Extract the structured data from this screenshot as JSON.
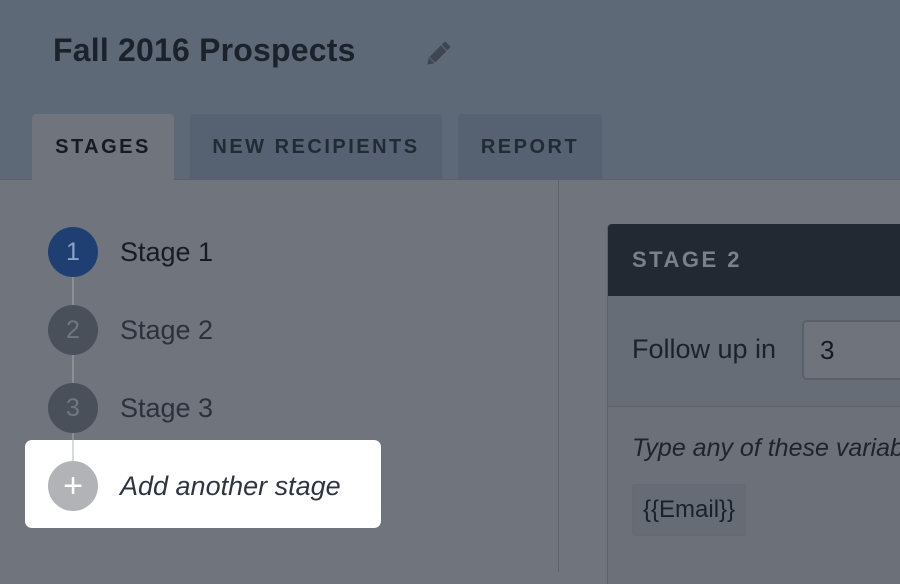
{
  "header": {
    "title": "Fall 2016 Prospects",
    "edit_icon": "pencil-icon"
  },
  "tabs": [
    {
      "label": "STAGES",
      "active": true
    },
    {
      "label": "NEW RECIPIENTS",
      "active": false
    },
    {
      "label": "REPORT",
      "active": false
    }
  ],
  "stages": [
    {
      "number": "1",
      "label": "Stage 1",
      "active": true
    },
    {
      "number": "2",
      "label": "Stage 2",
      "active": false
    },
    {
      "number": "3",
      "label": "Stage 3",
      "active": false
    }
  ],
  "add_stage": {
    "icon": "plus-icon",
    "icon_glyph": "+",
    "label": "Add another stage"
  },
  "panel": {
    "title": "STAGE 2",
    "follow_up_label": "Follow up in",
    "follow_up_value": "3",
    "variables_hint": "Type any of these variab",
    "variables": [
      "{{Email}}"
    ]
  },
  "colors": {
    "active_stage": "#1f3f72",
    "overlay_header": "#5e6978",
    "panel_header": "#222932"
  }
}
